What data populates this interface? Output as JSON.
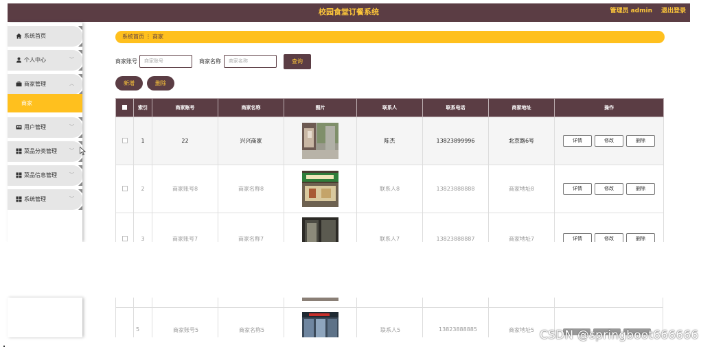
{
  "header": {
    "title": "校园食堂订餐系统",
    "admin_label": "管理员 admin",
    "logout_label": "退出登录"
  },
  "sidebar": {
    "items": [
      {
        "label": "系统首页",
        "icon": "home-icon"
      },
      {
        "label": "个人中心",
        "icon": "user-icon"
      },
      {
        "label": "商家管理",
        "icon": "briefcase-icon"
      },
      {
        "label": "用户管理",
        "icon": "id-card-icon"
      },
      {
        "label": "菜品分类管理",
        "icon": "grid-icon"
      },
      {
        "label": "菜品信息管理",
        "icon": "grid-icon"
      },
      {
        "label": "系统管理",
        "icon": "grid-icon"
      }
    ],
    "active_sub": "商家"
  },
  "breadcrumb": {
    "home": "系统首页",
    "separator": "⋮",
    "current": "商家"
  },
  "search": {
    "account_label": "商家账号",
    "account_placeholder": "商家账号",
    "name_label": "商家名称",
    "name_placeholder": "商家名称",
    "query_button": "查询"
  },
  "actions": {
    "add_button": "新增",
    "delete_button": "删除"
  },
  "table": {
    "columns": [
      "索引",
      "商家账号",
      "商家名称",
      "图片",
      "联系人",
      "联系电话",
      "商家地址",
      "操作"
    ],
    "rows": [
      {
        "index": "1",
        "account": "22",
        "name": "兴兴商家",
        "contact": "陈杰",
        "phone": "13823899996",
        "address": "北京路6号"
      },
      {
        "index": "2",
        "account": "商家账号8",
        "name": "商家名称8",
        "contact": "联系人8",
        "phone": "13823888888",
        "address": "商家地址8"
      },
      {
        "index": "3",
        "account": "商家账号7",
        "name": "商家名称7",
        "contact": "联系人7",
        "phone": "13823888887",
        "address": "商家地址7"
      },
      {
        "index": "5",
        "account": "商家账号5",
        "name": "商家名称5",
        "contact": "联系人5",
        "phone": "13823888885",
        "address": "商家地址5"
      }
    ],
    "row_actions": {
      "detail": "详情",
      "edit": "修改",
      "delete": "删除"
    }
  },
  "watermark": "CSDN @springboot666666",
  "colors": {
    "primary": "#5b3d44",
    "accent": "#ffc01e",
    "accent_text": "#ffc83a"
  }
}
